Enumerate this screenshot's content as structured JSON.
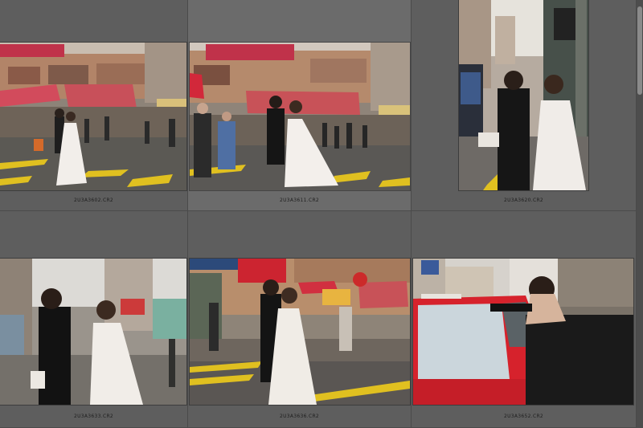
{
  "grid": {
    "cells": [
      {
        "filename": "2U3A3602.CR2",
        "scene": "street-crossing-couple-walking"
      },
      {
        "filename": "2U3A3611.CR2",
        "scene": "street-crossing-couple-walking-crowd"
      },
      {
        "filename": "2U3A3620.CR2",
        "scene": "portrait-couple-by-pole"
      },
      {
        "filename": "2U3A3633.CR2",
        "scene": "couple-laughing-street"
      },
      {
        "filename": "2U3A3636.CR2",
        "scene": "couple-crossing-street-sunny"
      },
      {
        "filename": "2U3A3652.CR2",
        "scene": "man-leaning-on-red-taxi"
      }
    ]
  },
  "colors": {
    "background": "#5e5e5e",
    "selected_cell": "#6b6b6b",
    "awning_red": "#c8505a",
    "taxi_red": "#d6222c",
    "crosswalk_yellow": "#e0c020"
  }
}
